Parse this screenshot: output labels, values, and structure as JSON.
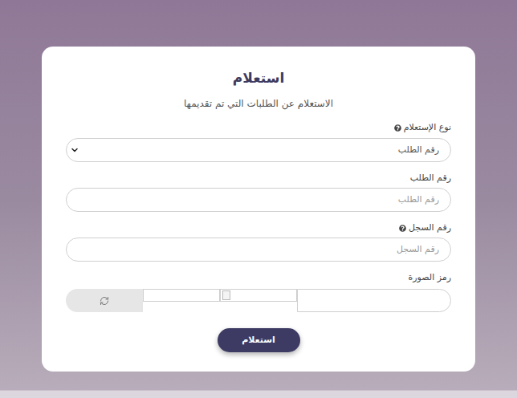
{
  "card": {
    "title": "استعلام",
    "subtitle": "الاستعلام عن الطلبات التي تم تقديمها"
  },
  "fields": [
    {
      "kind": "select",
      "label": "نوع الإستعلام",
      "help": true,
      "value": "رقم الطلب"
    },
    {
      "kind": "input",
      "label": "رقم الطلب",
      "help": false,
      "placeholder": "رقم الطلب"
    },
    {
      "kind": "input",
      "label": "رقم السجل",
      "help": true,
      "placeholder": "رقم السجل"
    },
    {
      "kind": "captcha",
      "label": "رمز الصورة",
      "help": false,
      "placeholder": ""
    }
  ],
  "buttons": [
    "استعلام"
  ]
}
